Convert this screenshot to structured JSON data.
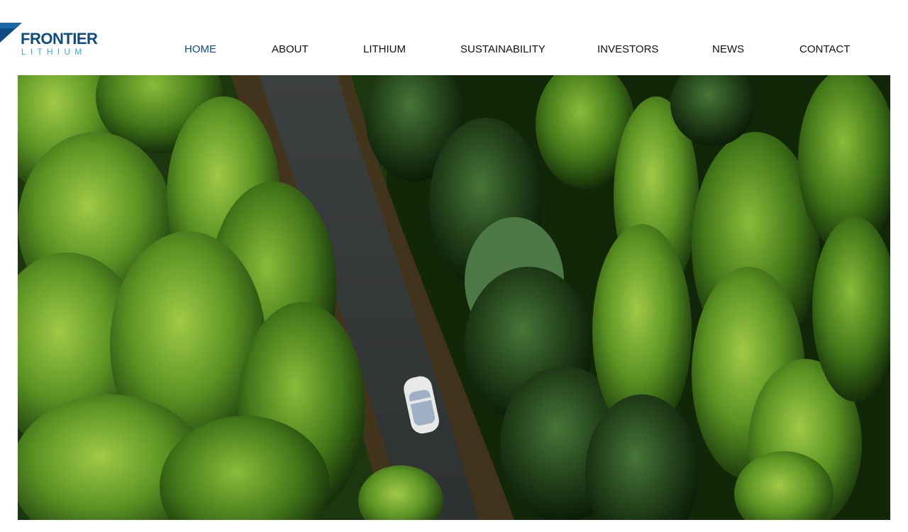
{
  "brand": {
    "name": "FRONTIER",
    "tagline": "LITHIUM",
    "primary_color": "#0f4c81",
    "accent_color": "#3fa9e0",
    "icon": "logo-chevron-icon"
  },
  "nav": {
    "items": [
      {
        "label": "HOME",
        "active": true
      },
      {
        "label": "ABOUT",
        "active": false
      },
      {
        "label": "LITHIUM",
        "active": false
      },
      {
        "label": "SUSTAINABILITY",
        "active": false
      },
      {
        "label": "INVESTORS",
        "active": false
      },
      {
        "label": "NEWS",
        "active": false
      },
      {
        "label": "CONTACT",
        "active": false
      }
    ]
  },
  "hero": {
    "image": "aerial view of white car on forest road"
  }
}
